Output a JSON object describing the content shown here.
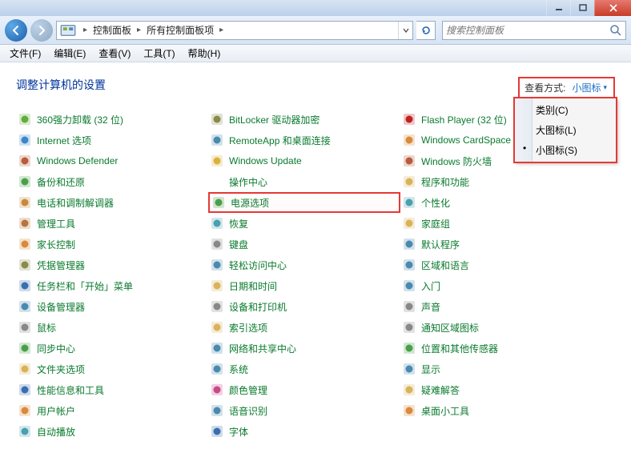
{
  "window": {
    "breadcrumb": [
      "控制面板",
      "所有控制面板项"
    ],
    "search_placeholder": "搜索控制面板"
  },
  "menus": [
    "文件(F)",
    "编辑(E)",
    "查看(V)",
    "工具(T)",
    "帮助(H)"
  ],
  "page_title": "调整计算机的设置",
  "view_by": {
    "label": "查看方式:",
    "selected": "小图标",
    "options": [
      "类别(C)",
      "大图标(L)",
      "小图标(S)"
    ],
    "selected_index": 2
  },
  "items": [
    {
      "label": "360强力卸载 (32 位)",
      "icon": "shield-green",
      "hl": false
    },
    {
      "label": "Internet 选项",
      "icon": "globe",
      "hl": false
    },
    {
      "label": "Windows Defender",
      "icon": "brick-wall",
      "hl": false
    },
    {
      "label": "备份和还原",
      "icon": "clock-arrow",
      "hl": false
    },
    {
      "label": "电话和调制解调器",
      "icon": "phone",
      "hl": false
    },
    {
      "label": "管理工具",
      "icon": "toolbox",
      "hl": false
    },
    {
      "label": "家长控制",
      "icon": "family",
      "hl": false
    },
    {
      "label": "凭据管理器",
      "icon": "safe",
      "hl": false
    },
    {
      "label": "任务栏和「开始」菜单",
      "icon": "taskbar",
      "hl": false
    },
    {
      "label": "设备管理器",
      "icon": "device",
      "hl": false
    },
    {
      "label": "鼠标",
      "icon": "mouse",
      "hl": false
    },
    {
      "label": "同步中心",
      "icon": "sync",
      "hl": false
    },
    {
      "label": "文件夹选项",
      "icon": "folder",
      "hl": false
    },
    {
      "label": "性能信息和工具",
      "icon": "gauge",
      "hl": false
    },
    {
      "label": "用户帐户",
      "icon": "users",
      "hl": false
    },
    {
      "label": "自动播放",
      "icon": "disc",
      "hl": false
    },
    {
      "label": "BitLocker 驱动器加密",
      "icon": "lock-drive",
      "hl": false
    },
    {
      "label": "RemoteApp 和桌面连接",
      "icon": "remote",
      "hl": false
    },
    {
      "label": "Windows Update",
      "icon": "update",
      "hl": false
    },
    {
      "label": "操作中心",
      "icon": "flag",
      "hl": false
    },
    {
      "label": "电源选项",
      "icon": "power",
      "hl": true
    },
    {
      "label": "恢复",
      "icon": "restore",
      "hl": false
    },
    {
      "label": "键盘",
      "icon": "keyboard",
      "hl": false
    },
    {
      "label": "轻松访问中心",
      "icon": "ease",
      "hl": false
    },
    {
      "label": "日期和时间",
      "icon": "clock",
      "hl": false
    },
    {
      "label": "设备和打印机",
      "icon": "printer",
      "hl": false
    },
    {
      "label": "索引选项",
      "icon": "index",
      "hl": false
    },
    {
      "label": "网络和共享中心",
      "icon": "network",
      "hl": false
    },
    {
      "label": "系统",
      "icon": "system",
      "hl": false
    },
    {
      "label": "颜色管理",
      "icon": "color",
      "hl": false
    },
    {
      "label": "语音识别",
      "icon": "mic",
      "hl": false
    },
    {
      "label": "字体",
      "icon": "font",
      "hl": false
    },
    {
      "label": "Flash Player (32 位)",
      "icon": "flash",
      "hl": false
    },
    {
      "label": "Windows CardSpace",
      "icon": "card",
      "hl": false
    },
    {
      "label": "Windows 防火墙",
      "icon": "firewall",
      "hl": false
    },
    {
      "label": "程序和功能",
      "icon": "programs",
      "hl": false
    },
    {
      "label": "个性化",
      "icon": "personalize",
      "hl": false
    },
    {
      "label": "家庭组",
      "icon": "homegroup",
      "hl": false
    },
    {
      "label": "默认程序",
      "icon": "defaults",
      "hl": false
    },
    {
      "label": "区域和语言",
      "icon": "region",
      "hl": false
    },
    {
      "label": "入门",
      "icon": "getstarted",
      "hl": false
    },
    {
      "label": "声音",
      "icon": "sound",
      "hl": false
    },
    {
      "label": "通知区域图标",
      "icon": "tray",
      "hl": false
    },
    {
      "label": "位置和其他传感器",
      "icon": "location",
      "hl": false
    },
    {
      "label": "显示",
      "icon": "display",
      "hl": false
    },
    {
      "label": "疑难解答",
      "icon": "troubleshoot",
      "hl": false
    },
    {
      "label": "桌面小工具",
      "icon": "gadgets",
      "hl": false
    }
  ]
}
